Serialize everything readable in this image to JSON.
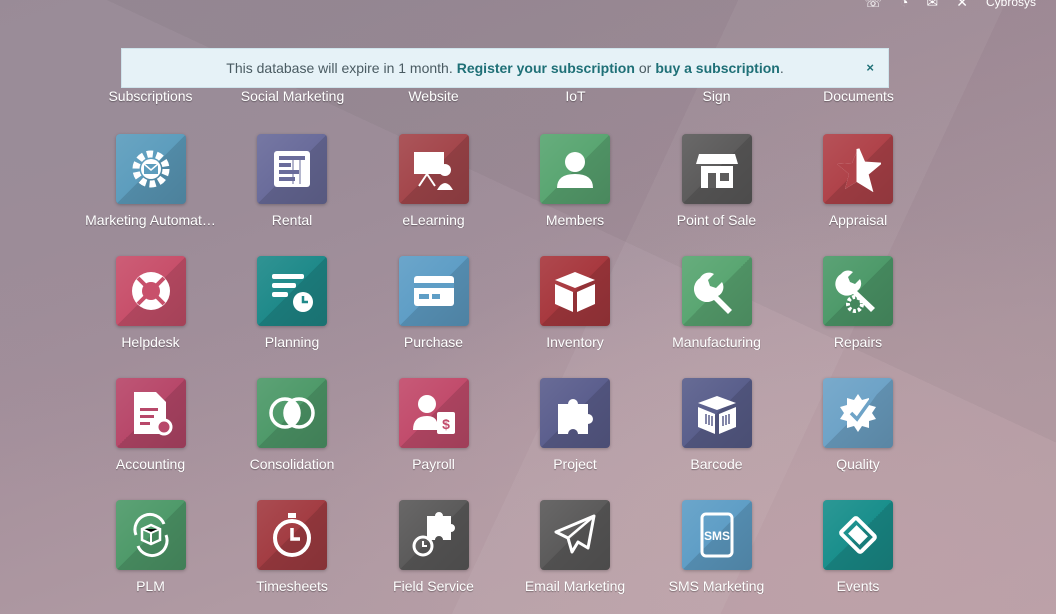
{
  "systray": {
    "user": "Cybrosys"
  },
  "banner": {
    "text": "This database will expire in 1 month.",
    "register_link": "Register your subscription",
    "or": "or",
    "buy_link": "buy a subscription",
    "end": ".",
    "close": "×"
  },
  "partial_row": [
    "Subscriptions",
    "Social Marketing",
    "Website",
    "IoT",
    "Sign",
    "Documents"
  ],
  "apps": [
    {
      "label": "Marketing Automat…",
      "icon": "marketing-automation-icon",
      "color": "#5d9dbd"
    },
    {
      "label": "Rental",
      "icon": "rental-icon",
      "color": "#6a6c9b"
    },
    {
      "label": "eLearning",
      "icon": "elearning-icon",
      "color": "#a4474c"
    },
    {
      "label": "Members",
      "icon": "members-icon",
      "color": "#5aa672"
    },
    {
      "label": "Point of Sale",
      "icon": "point-of-sale-icon",
      "color": "#5d5c5c"
    },
    {
      "label": "Appraisal",
      "icon": "appraisal-icon",
      "color": "#b0434a"
    },
    {
      "label": "Helpdesk",
      "icon": "helpdesk-icon",
      "color": "#c8506b"
    },
    {
      "label": "Planning",
      "icon": "planning-icon",
      "color": "#1f8a8a"
    },
    {
      "label": "Purchase",
      "icon": "purchase-icon",
      "color": "#5f9ec6"
    },
    {
      "label": "Inventory",
      "icon": "inventory-icon",
      "color": "#a8393f"
    },
    {
      "label": "Manufacturing",
      "icon": "manufacturing-icon",
      "color": "#5aa672"
    },
    {
      "label": "Repairs",
      "icon": "repairs-icon",
      "color": "#4e9a6a"
    },
    {
      "label": "Accounting",
      "icon": "accounting-icon",
      "color": "#b8486a"
    },
    {
      "label": "Consolidation",
      "icon": "consolidation-icon",
      "color": "#4f9a6a"
    },
    {
      "label": "Payroll",
      "icon": "payroll-icon",
      "color": "#c24c6c"
    },
    {
      "label": "Project",
      "icon": "project-icon",
      "color": "#5c5f8e"
    },
    {
      "label": "Barcode",
      "icon": "barcode-icon",
      "color": "#5a5f8c"
    },
    {
      "label": "Quality",
      "icon": "quality-icon",
      "color": "#6ea3c7"
    },
    {
      "label": "PLM",
      "icon": "plm-icon",
      "color": "#4f9a6a"
    },
    {
      "label": "Timesheets",
      "icon": "timesheets-icon",
      "color": "#a33d43"
    },
    {
      "label": "Field Service",
      "icon": "field-service-icon",
      "color": "#5c5b5b"
    },
    {
      "label": "Email Marketing",
      "icon": "email-marketing-icon",
      "color": "#5c5b5b"
    },
    {
      "label": "SMS Marketing",
      "icon": "sms-marketing-icon",
      "color": "#5f9ec6"
    },
    {
      "label": "Events",
      "icon": "events-icon",
      "color": "#1a8f8c"
    }
  ]
}
